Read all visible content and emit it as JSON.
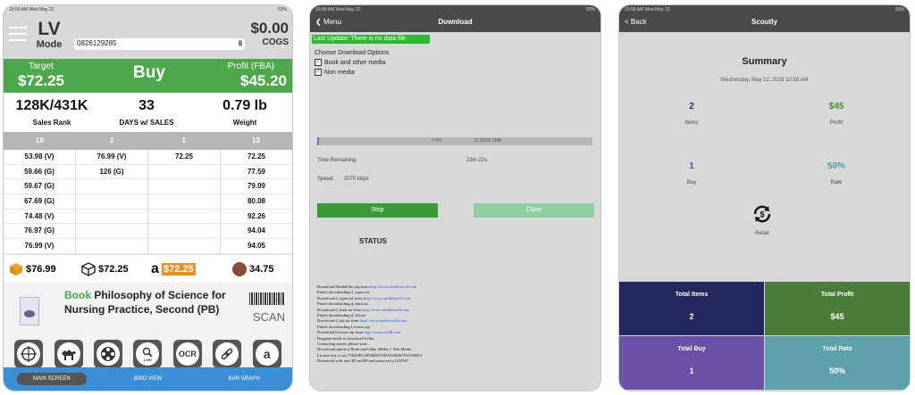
{
  "colors": {
    "accent_green": "#4ca84a",
    "nav_blue": "#3b8fd6",
    "tile_navy": "#24285f",
    "tile_green": "#4b7d3a",
    "tile_purple": "#6a50a6",
    "tile_teal": "#5ea1aa"
  },
  "screen1": {
    "status": {
      "time": "10:50 AM  Wed May 22",
      "battery": "53%"
    },
    "header": {
      "mode_top": "LV",
      "mode_bottom": "Mode",
      "asin": "0826129285",
      "cogs_value": "$0.00",
      "cogs_label": "COGS"
    },
    "decision": {
      "target_label": "Target",
      "target_value": "$72.25",
      "verdict": "Buy",
      "profit_label": "Profit (FBA)",
      "profit_value": "$45.20"
    },
    "stats": [
      {
        "value": "128K/431K",
        "label": "Sales Rank"
      },
      {
        "value": "33",
        "label": "DAYS w/ SALES"
      },
      {
        "value": "0.79 lb",
        "label": "Weight"
      }
    ],
    "offer_headers": [
      "19",
      "2",
      "1",
      "12"
    ],
    "offer_columns": [
      [
        "53.98 (V)",
        "59.66 (G)",
        "59.67 (G)",
        "67.69 (G)",
        "74.48 (V)",
        "76.97 (G)",
        "76.99 (V)"
      ],
      [
        "76.99 (V)",
        "126 (G)"
      ],
      [
        "72.25"
      ],
      [
        "72.25",
        "77.59",
        "79.09",
        "80.08",
        "92.26",
        "94.04",
        "94.05"
      ]
    ],
    "prices": {
      "fba": "$76.99",
      "mf": "$72.25",
      "amazon": "$72.25",
      "other": "34.75"
    },
    "book": {
      "tag": "Book",
      "title": " Philosophy of Science for Nursing Practice, Second (PB)"
    },
    "scan_label": "SCAN",
    "tools": {
      "live": "LIVE",
      "ocr": "OCR",
      "amazon": "a"
    },
    "nav": [
      "MAIN SCREEN",
      "BIRD VIEW",
      "BAR GRAPH"
    ]
  },
  "screen2": {
    "status": {
      "time": "10:58 AM  Wed May 22",
      "battery": "52%"
    },
    "back": "Menu",
    "title": "Download",
    "last_update": "Last Update: There is no data file",
    "options_heading": "Choose Download Options",
    "options": [
      "Book and other media",
      "Non media"
    ],
    "progress": {
      "fraction": 0.005,
      "percent_text": "0.5%",
      "size_text": "12.8/555.2MB"
    },
    "time_remaining_label": "Time Remaining:",
    "time_remaining_value": "23m 22s",
    "speed_label": "Speed:",
    "speed_value": "2070 kbps",
    "stop": "Stop",
    "close": "Close",
    "status_heading": "STATUS",
    "log": [
      {
        "text": "Download MediaFiles.zip from ",
        "url": "http://www.asellertool3.com"
      },
      {
        "text": "Finish downloading d_types.txt",
        "url": ""
      },
      {
        "text": "Download d_types.txt from ",
        "url": "http://www.asellertool3.com"
      },
      {
        "text": "Finish downloading d_limit.txt",
        "url": ""
      },
      {
        "text": "Download d_limit.txt from ",
        "url": "http://www.asellertool3.com"
      },
      {
        "text": "Finish downloading d_list.txt",
        "url": ""
      },
      {
        "text": "Download d_list.txt from ",
        "url": "http://www.asellertool3.com"
      },
      {
        "text": "Finish downloading License.zip",
        "url": ""
      },
      {
        "text": "Download License.zip from ",
        "url": "http://www.ast28.com"
      },
      {
        "text": "Program needs to download 6 files",
        "url": ""
      },
      {
        "text": "Contacting server, please wait...",
        "url": ""
      },
      {
        "text": "Download option is Book and Other Media + Non Media",
        "url": ""
      },
      {
        "text": "License key is ad_75D43EC2F94D8073DAA5E067F3A596EA",
        "url": ""
      },
      {
        "text": "Download with user ID ast208 and password y1234567",
        "url": ""
      }
    ]
  },
  "screen3": {
    "status": {
      "time": "10:59 AM  Wed May 22",
      "battery": "53%"
    },
    "back": "Back",
    "title": "Scoutly",
    "heading": "Summary",
    "date": "Wednesday, May 22, 2019 10:58 AM",
    "metrics": [
      {
        "value": "2",
        "label": "Items",
        "color": "#2a2f7a"
      },
      {
        "value": "$45",
        "label": "Profit",
        "color": "#3e8a2e"
      },
      {
        "value": "1",
        "label": "Buy",
        "color": "#5a4a9a"
      },
      {
        "value": "50%",
        "label": "Rate",
        "color": "#4a9aa8"
      }
    ],
    "reset": "Reset",
    "tiles": [
      {
        "label": "Total Items",
        "value": "2"
      },
      {
        "label": "Total Profit",
        "value": "$45"
      },
      {
        "label": "Total Buy",
        "value": "1"
      },
      {
        "label": "Total Rate",
        "value": "50%"
      }
    ]
  }
}
